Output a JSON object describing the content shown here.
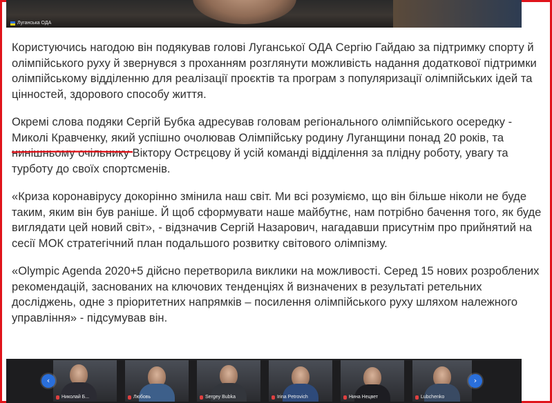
{
  "top_video": {
    "caption": "Луганська ОДА"
  },
  "article": {
    "paragraphs": [
      "Користуючись нагодою він подякував голові Луганської ОДА  Сергію Гайдаю за підтримку спорту й олімпійського руху й звернувся з проханням  розглянути можливість надання додаткової підтримки олімпійському відділенню для реалізації проєктів та програм з популяризації олімпійських ідей та цінностей, здорового способу життя.",
      "Окремі слова подяки Сергій Бубка адресував головам регіонального олімпійського осередку - Миколі Кравченку, який успішно очолював Олімпійську родину Луганщини понад 20 років, та нинішньому очільнику Віктору Острєцову й усій команді відділення за плідну роботу, увагу та турботу до своїх спортсменів.",
      "«Криза коронавірусу докорінно змінила наш світ. Ми всі розуміємо, що він більше ніколи не буде таким, яким він був раніше. Й щоб сформувати наше майбутнє, нам потрібно бачення того, як буде виглядати цей новий світ», - відзначив Сергій Назарович, нагадавши присутнім про прийнятий на сесії МОК стратегічний план подальшого розвитку світового олімпізму.",
      "«Olympic Agenda 2020+5 дійсно перетворила виклики на можливості.  Серед 15 нових розроблених рекомендацій, заснованих на ключових тенденціях й визначених в результаті ретельних досліджень, одне з пріоритетних напрямків – посилення олімпійського руху шляхом належного управління» - підсумував він."
    ]
  },
  "gallery": {
    "prev_icon": "‹",
    "next_icon": "›",
    "tiles": [
      {
        "name": "Николай Б...",
        "body_color": "#2b2b33"
      },
      {
        "name": "Любовь",
        "body_color": "#3d5f8a"
      },
      {
        "name": "Sergey Bubka",
        "body_color": "#33363c"
      },
      {
        "name": "Irina Petrovich",
        "body_color": "#2e4a7a"
      },
      {
        "name": "Нина Нецвет",
        "body_color": "#1d1d22"
      },
      {
        "name": "Lubchenko",
        "body_color": "#394a63"
      }
    ]
  },
  "colors": {
    "frame_border": "#e0141b",
    "underline": "#e0141b",
    "nav_button": "#2a6fdb",
    "text": "#303030"
  }
}
